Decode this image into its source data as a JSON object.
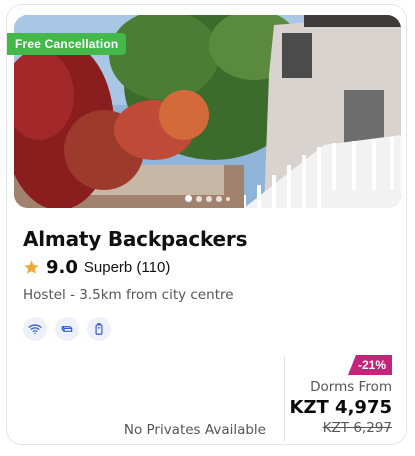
{
  "card": {
    "badge": "Free Cancellation",
    "title": "Almaty Backpackers",
    "rating": {
      "score": "9.0",
      "label": "Superb (110)"
    },
    "subtitle": "Hostel - 3.5km from city centre",
    "amenities": [
      "wifi-icon",
      "linen-icon",
      "locker-icon"
    ],
    "no_privates": "No Privates Available",
    "pricing": {
      "discount": "-21%",
      "dorms_label": "Dorms From",
      "price": "KZT 4,975",
      "old_price": "KZT 6,297"
    },
    "carousel": {
      "total_dots": 5,
      "active_index": 0
    }
  },
  "colors": {
    "badge": "#43b94c",
    "discount": "#c8237a",
    "star": "#f2a93b",
    "amenity_bg": "#eef1fb",
    "amenity_icon": "#2f5bd3"
  }
}
